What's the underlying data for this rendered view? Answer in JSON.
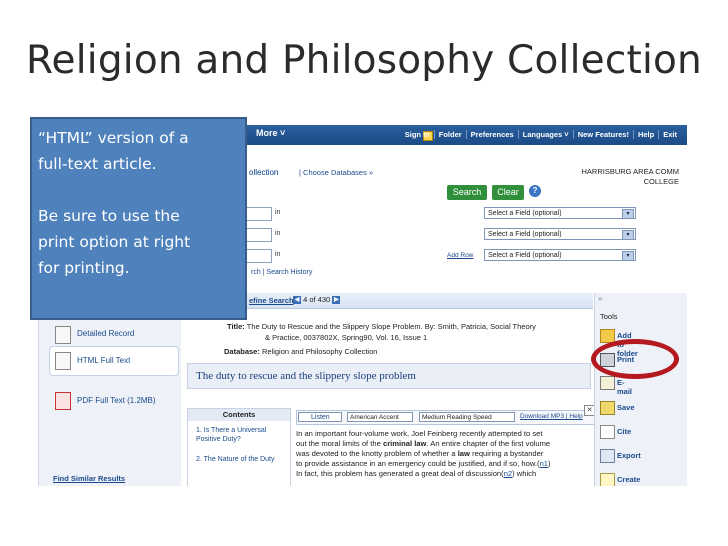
{
  "slide": {
    "title": "Religion and Philosophy Collection",
    "callout": "“HTML” version of a\nfull-text article.\n\nBe sure to use the\nprint option at right\nfor printing."
  },
  "topbar": {
    "more": "More ˅",
    "links": [
      "Sign In",
      "Folder",
      "Preferences",
      "Languages ˅",
      "New Features!",
      "Help",
      "Exit"
    ]
  },
  "header": {
    "collection_fragment": "ollection",
    "choose_databases": "Choose Databases »",
    "institution_line1": "HARRISBURG AREA COMM",
    "institution_line2": "COLLEGE"
  },
  "search": {
    "in_label": "in",
    "field_placeholder": "Select a Field (optional)",
    "search_button": "Search",
    "clear_button": "Clear",
    "add_row": "Add Row",
    "links": "rch | Search History"
  },
  "results": {
    "refine": "efine Search",
    "position": "4 of 430"
  },
  "sidebar": {
    "items": [
      "Detailed Record",
      "HTML Full Text",
      "PDF Full Text",
      "(1.2MB)"
    ],
    "find_similar": "Find Similar Results"
  },
  "record": {
    "title_label": "Title:",
    "title_line1": "The Duty to Rescue and the Slippery Slope Problem. By: Smith, Patricia, Social Theory",
    "title_line2": "& Practice, 0037802X, Spring90, Vol. 16, Issue 1",
    "db_label": "Database:",
    "db_value": "Religion and Philosophy Collection",
    "article_title": "The duty to rescue and the slippery slope problem"
  },
  "contents": {
    "heading": "Contents",
    "item1": "1.   Is   There   a Universal  Positive Duty?",
    "item2": "2. The Nature of the Duty"
  },
  "listen": {
    "button": "Listen",
    "accent": "American Accent",
    "speed": "Medium Reading Speed",
    "download": "Download MP3",
    "help": "Help"
  },
  "body": {
    "line1": "In an important four-volume work, Joel Feinberg recently attempted to set",
    "line2": "out the moral limits of the",
    "criminal_law": "criminal law",
    "line2b": ". An entire chapter of the first volume",
    "line3a": "was devoted to the knotty problem of whether a",
    "law_word": "law",
    "line3b": "requiring a bystander",
    "line4": "to provide assistance in an emergency could be justified, and if so, how.(",
    "n1": "n1",
    "line4b": ")",
    "line5a": "In fact, this problem has generated a great deal of discussion(",
    "n2": "n2",
    "line5b": ") which"
  },
  "tools": {
    "heading": "Tools",
    "items": [
      "Add to folder",
      "Print",
      "E-mail",
      "Save",
      "Cite",
      "Export",
      "Create Note"
    ]
  },
  "colors": {
    "callout_bg": "#4f81bd",
    "highlight_oval": "#b3191f",
    "topbar": "#1c4b86",
    "button_green": "#2f8f3a"
  }
}
